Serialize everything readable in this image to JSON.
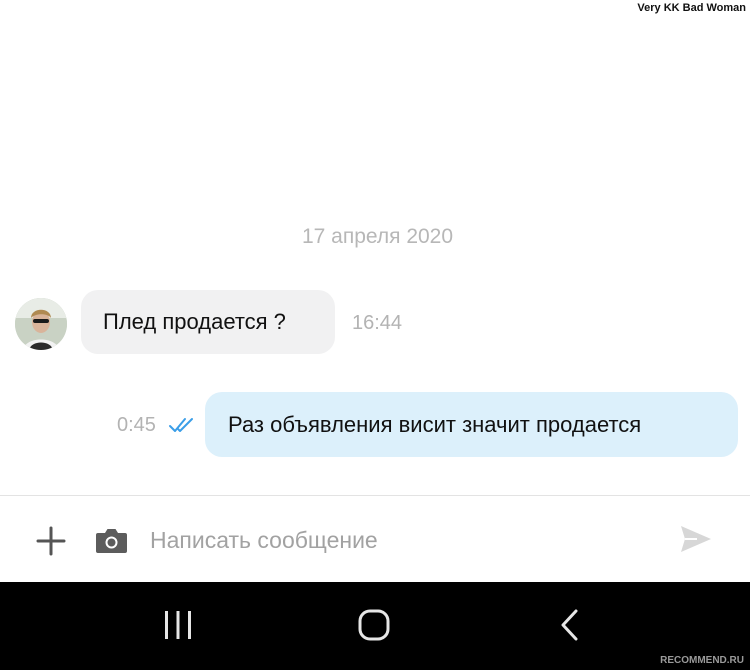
{
  "watermark_top": "Very KK Bad Woman",
  "chat": {
    "date_separator": "17 апреля 2020",
    "messages": [
      {
        "direction": "incoming",
        "text": "Плед продается ?",
        "time": "16:44"
      },
      {
        "direction": "outgoing",
        "text": "Раз объявления висит значит продается",
        "time": "0:45",
        "status_icon": "double-check-icon"
      }
    ]
  },
  "composer": {
    "placeholder": "Написать сообщение",
    "value": "",
    "icons": [
      "plus-icon",
      "camera-icon",
      "send-icon"
    ]
  },
  "navbar": {
    "icons": [
      "recent-apps-icon",
      "home-icon",
      "back-icon"
    ]
  },
  "watermark_bottom": "RECOMMEND.RU",
  "colors": {
    "incoming_bubble": "#f1f1f2",
    "outgoing_bubble": "#dcf0fb",
    "read_check": "#3a9ee8",
    "muted_text": "#b3b3b3",
    "navbar_bg": "#000000"
  }
}
